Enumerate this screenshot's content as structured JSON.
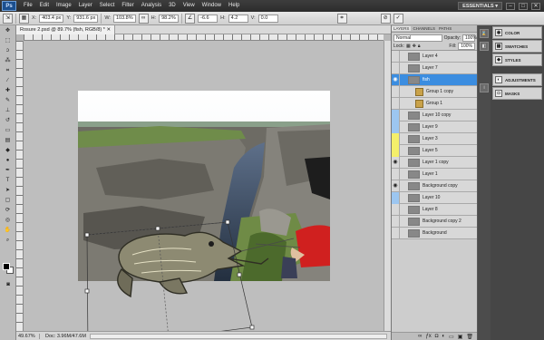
{
  "app": {
    "logo": "Ps"
  },
  "menu": {
    "items": [
      "File",
      "Edit",
      "Image",
      "Layer",
      "Select",
      "Filter",
      "Analysis",
      "3D",
      "View",
      "Window",
      "Help"
    ]
  },
  "workspace": {
    "label": "ESSENTIALS ▾",
    "minimize": "–",
    "restore": "□",
    "close": "✕"
  },
  "options": {
    "x_label": "X:",
    "x_value": "403.4 px",
    "y_label": "Y:",
    "y_value": "931.6 px",
    "w_label": "W:",
    "w_value": "103.8%",
    "h_label": "H:",
    "h_value": "98.2%",
    "angle_value": "-6.6",
    "hskew_label": "H:",
    "hskew_value": "4.2",
    "vskew_label": "V:",
    "vskew_value": "0.0"
  },
  "document": {
    "tab_title": "Rosure 2.psd @ 89.7% (fish, RGB/8) *  ✕",
    "zoom": "49.67%",
    "doc_size": "Doc: 3.96M/47.6M"
  },
  "layers_panel": {
    "tabs": [
      "LAYERS",
      "CHANNELS",
      "PATHS"
    ],
    "blend_mode": "Normal",
    "opacity_label": "Opacity:",
    "opacity_value": "100%",
    "fill_label": "Fill:",
    "fill_value": "100%",
    "lock_label": "Lock:",
    "layers": [
      {
        "name": "Layer 4",
        "visible": false,
        "selected": false,
        "group": false,
        "color": ""
      },
      {
        "name": "Layer 7",
        "visible": false,
        "selected": false,
        "group": false,
        "color": ""
      },
      {
        "name": "fish",
        "visible": true,
        "selected": true,
        "group": false,
        "color": ""
      },
      {
        "name": "Group 1 copy",
        "visible": false,
        "selected": false,
        "group": true,
        "color": ""
      },
      {
        "name": "Group 1",
        "visible": false,
        "selected": false,
        "group": true,
        "color": ""
      },
      {
        "name": "Layer 10 copy",
        "visible": false,
        "selected": false,
        "group": false,
        "color": "#9cc6f0"
      },
      {
        "name": "Layer 9",
        "visible": false,
        "selected": false,
        "group": false,
        "color": "#9cc6f0"
      },
      {
        "name": "Layer 3",
        "visible": false,
        "selected": false,
        "group": false,
        "color": "#f4ef6a"
      },
      {
        "name": "Layer 5",
        "visible": false,
        "selected": false,
        "group": false,
        "color": "#f4ef6a"
      },
      {
        "name": "Layer 1 copy",
        "visible": true,
        "selected": false,
        "group": false,
        "color": ""
      },
      {
        "name": "Layer 1",
        "visible": false,
        "selected": false,
        "group": false,
        "color": ""
      },
      {
        "name": "Background copy",
        "visible": true,
        "selected": false,
        "group": false,
        "color": ""
      },
      {
        "name": "Layer 10",
        "visible": false,
        "selected": false,
        "group": false,
        "color": "#9cc6f0"
      },
      {
        "name": "Layer 8",
        "visible": false,
        "selected": false,
        "group": false,
        "color": ""
      },
      {
        "name": "Background copy 2",
        "visible": false,
        "selected": false,
        "group": false,
        "color": ""
      },
      {
        "name": "Background",
        "visible": false,
        "selected": false,
        "group": false,
        "color": ""
      }
    ]
  },
  "side_panels": {
    "group1": [
      {
        "label": "COLOR",
        "icon": "color-icon"
      },
      {
        "label": "SWATCHES",
        "icon": "swatches-icon"
      },
      {
        "label": "STYLES",
        "icon": "styles-icon"
      }
    ],
    "group2": [
      {
        "label": "ADJUSTMENTS",
        "icon": "adjustments-icon"
      },
      {
        "label": "MASKS",
        "icon": "masks-icon"
      }
    ]
  }
}
